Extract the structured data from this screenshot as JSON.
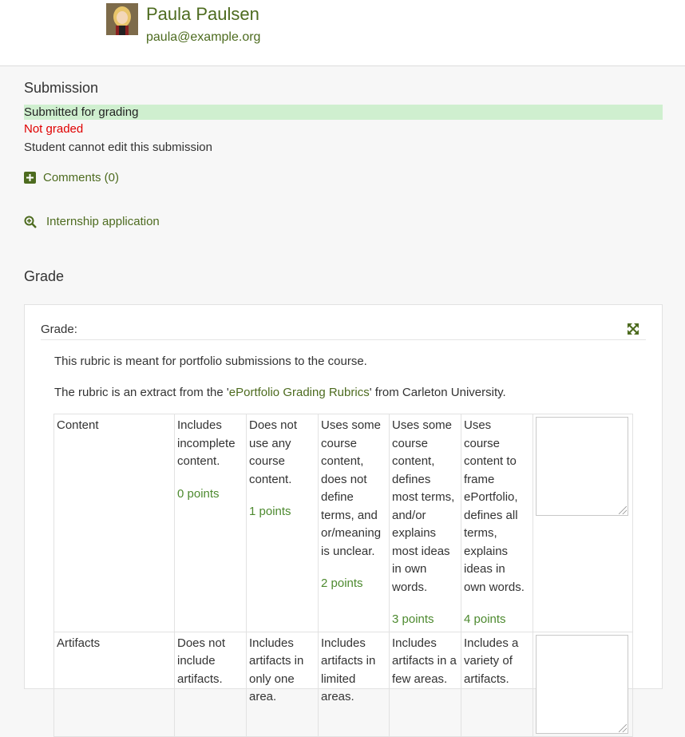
{
  "user": {
    "name": "Paula Paulsen",
    "email": "paula@example.org"
  },
  "submission": {
    "title": "Submission",
    "status_submitted": "Submitted for grading",
    "status_graded": "Not graded",
    "status_edit": "Student cannot edit this submission",
    "comments_label": "Comments (0)",
    "file_link": "Internship application"
  },
  "grade": {
    "section_title": "Grade",
    "panel_label": "Grade:",
    "description_1": "This rubric is meant for portfolio submissions to the course.",
    "description_2_prefix": "The rubric is an extract from the '",
    "description_2_link": "ePortfolio Grading Rubrics",
    "description_2_suffix": "' from Carleton University.",
    "criteria": [
      {
        "name": "Content",
        "levels": [
          {
            "text": "Includes incomplete content.",
            "points": "0 points"
          },
          {
            "text": "Does not use any course content.",
            "points": "1 points"
          },
          {
            "text": "Uses some course content, does not define terms, and or/meaning is unclear.",
            "points": "2 points"
          },
          {
            "text": "Uses some course content, defines most terms, and/or explains most ideas in own words.",
            "points": "3 points"
          },
          {
            "text": "Uses course content to frame ePortfolio, defines all terms, explains ideas in own words.",
            "points": "4 points"
          }
        ]
      },
      {
        "name": "Artifacts",
        "levels": [
          {
            "text": "Does not include artifacts.",
            "points": ""
          },
          {
            "text": "Includes artifacts in only one area.",
            "points": ""
          },
          {
            "text": "Includes artifacts in limited areas.",
            "points": ""
          },
          {
            "text": "Includes artifacts in a few areas.",
            "points": ""
          },
          {
            "text": "Includes a variety of artifacts.",
            "points": ""
          }
        ]
      }
    ]
  },
  "colors": {
    "accent": "#4d6b1f",
    "points": "#4d8a2f",
    "submitted_bg": "#cfefcf",
    "not_graded": "#e00000"
  }
}
